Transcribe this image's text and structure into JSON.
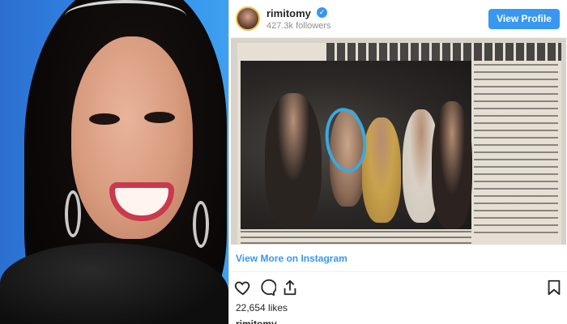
{
  "embed": {
    "username": "rimitomy",
    "verified_icon": "verified-badge-icon",
    "followers": "427.3k followers",
    "view_profile_label": "View Profile",
    "view_more_label": "View More on Instagram",
    "likes": "22,654 likes",
    "caption_username": "rimitomy",
    "accent_color": "#3897f0"
  },
  "icons": {
    "like": "heart-icon",
    "comment": "comment-bubble-icon",
    "share": "share-icon",
    "save": "bookmark-icon"
  }
}
